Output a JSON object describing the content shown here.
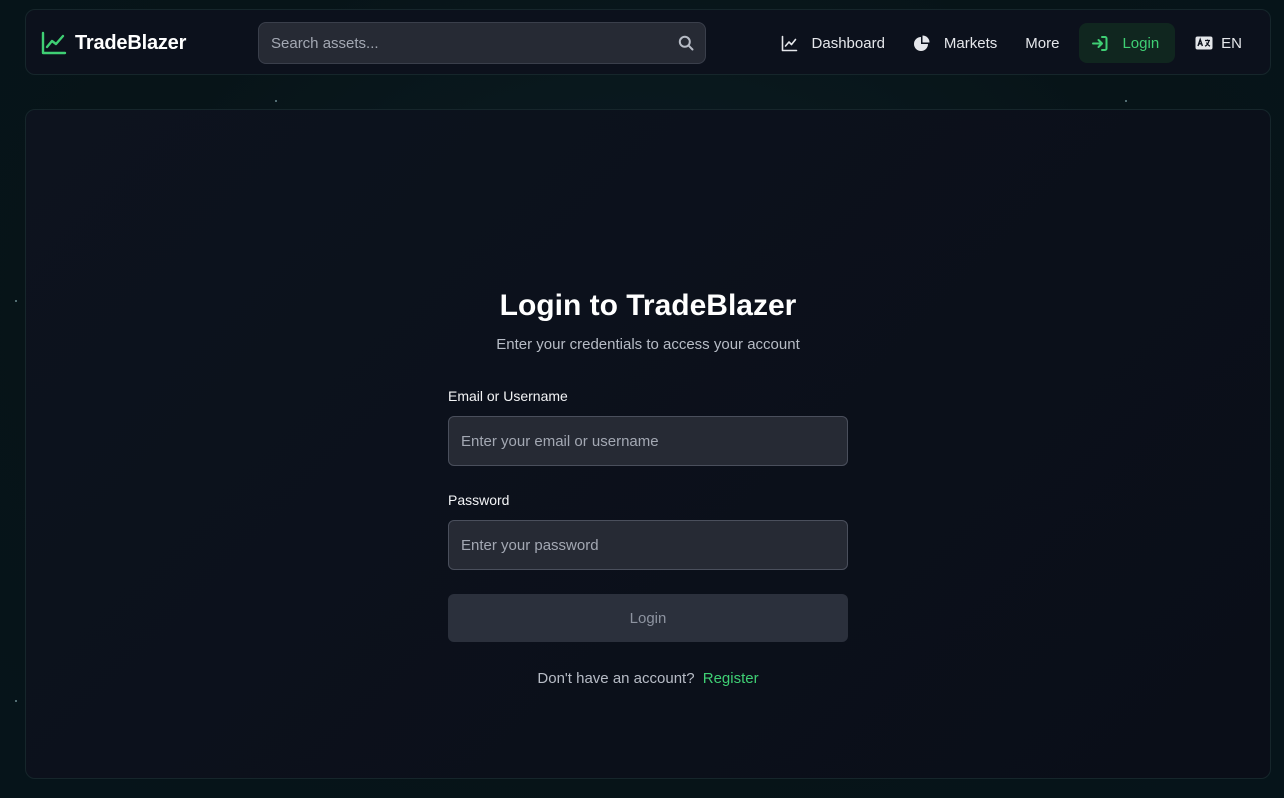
{
  "header": {
    "brand": "TradeBlazer",
    "search": {
      "placeholder": "Search assets..."
    },
    "nav": {
      "dashboard": "Dashboard",
      "markets": "Markets",
      "more": "More",
      "login": "Login",
      "language": "EN"
    }
  },
  "login": {
    "title": "Login to TradeBlazer",
    "subtitle": "Enter your credentials to access your account",
    "email_label": "Email or Username",
    "email_placeholder": "Enter your email or username",
    "password_label": "Password",
    "password_placeholder": "Enter your password",
    "submit_label": "Login",
    "register_prompt": "Don't have an account?",
    "register_link": "Register"
  },
  "colors": {
    "accent": "#3fcf74",
    "background": "#071418",
    "card": "#0c111c",
    "input": "#262a34"
  },
  "icons": {
    "brand": "trend-chart-icon",
    "search": "search-icon",
    "dashboard": "line-chart-icon",
    "markets": "pie-chart-icon",
    "login": "sign-in-icon",
    "language": "language-icon"
  }
}
